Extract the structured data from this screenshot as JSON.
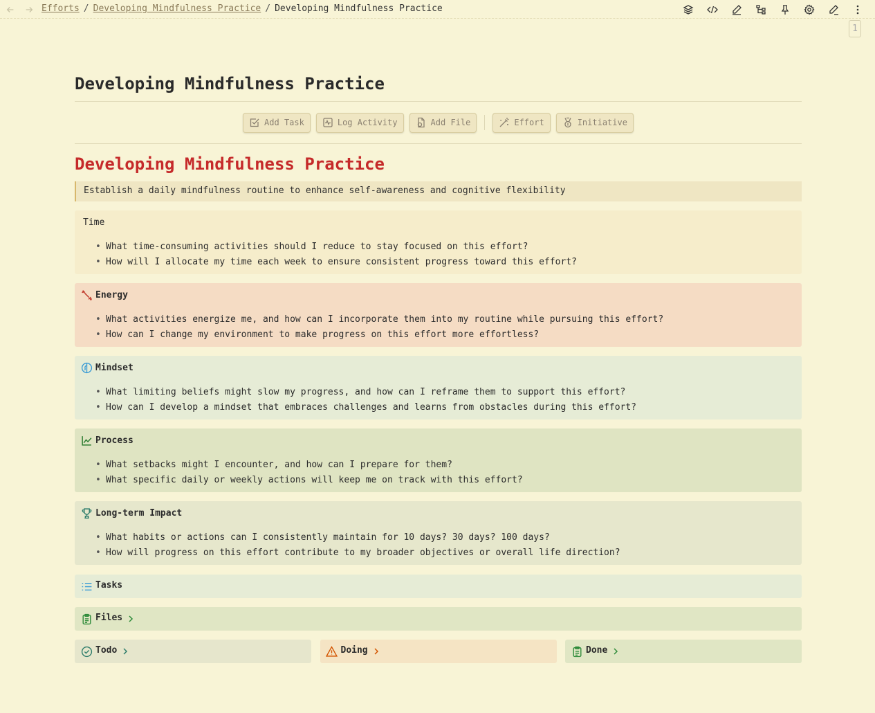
{
  "breadcrumb": {
    "items": [
      "Efforts",
      "Developing Mindfulness Practice"
    ],
    "current": "Developing Mindfulness Practice",
    "separator": "/"
  },
  "toolbar": {
    "icons": [
      "layers-icon",
      "code-icon",
      "pencil-icon",
      "tree-icon",
      "pin-icon",
      "gear-icon",
      "edit-icon",
      "more-vertical-icon"
    ]
  },
  "page_badge": "1",
  "page_title": "Developing Mindfulness Practice",
  "actions": {
    "add_task": "Add Task",
    "log_activity": "Log Activity",
    "add_file": "Add File",
    "effort": "Effort",
    "initiative": "Initiative"
  },
  "effort": {
    "title": "Developing Mindfulness Practice",
    "description": "Establish a daily mindfulness routine to enhance self-awareness and cognitive flexibility"
  },
  "callouts": {
    "time": {
      "title": "Time",
      "items": [
        "What time-consuming activities should I reduce to stay focused on this effort?",
        "How will I allocate my time each week to ensure consistent progress toward this effort?"
      ]
    },
    "energy": {
      "title": "Energy",
      "items": [
        "What activities energize me, and how can I incorporate them into my routine while pursuing this effort?",
        "How can I change my environment to make progress on this effort more effortless?"
      ]
    },
    "mindset": {
      "title": "Mindset",
      "items": [
        "What limiting beliefs might slow my progress, and how can I reframe them to support this effort?",
        "How can I develop a mindset that embraces challenges and learns from obstacles during this effort?"
      ]
    },
    "process": {
      "title": "Process",
      "items": [
        "What setbacks might I encounter, and how can I prepare for them?",
        "What specific daily or weekly actions will keep me on track with this effort?"
      ]
    },
    "impact": {
      "title": "Long-term Impact",
      "items": [
        "What habits or actions can I consistently maintain for 10 days? 30 days? 100 days?",
        "How will progress on this effort contribute to my broader objectives or overall life direction?"
      ]
    }
  },
  "sections": {
    "tasks": "Tasks",
    "files": "Files",
    "todo": "Todo",
    "doing": "Doing",
    "done": "Done"
  },
  "colors": {
    "background": "#f8f4d6",
    "effort_title": "#c52a2a",
    "energy_icon": "#c0392b",
    "mindset_icon": "#3a9bd5",
    "process_icon": "#2e7d32",
    "impact_icon": "#2e7d6b",
    "tasks_icon": "#3a9bd5",
    "files_icon": "#2e8b3a",
    "doing_icon": "#d35400"
  }
}
